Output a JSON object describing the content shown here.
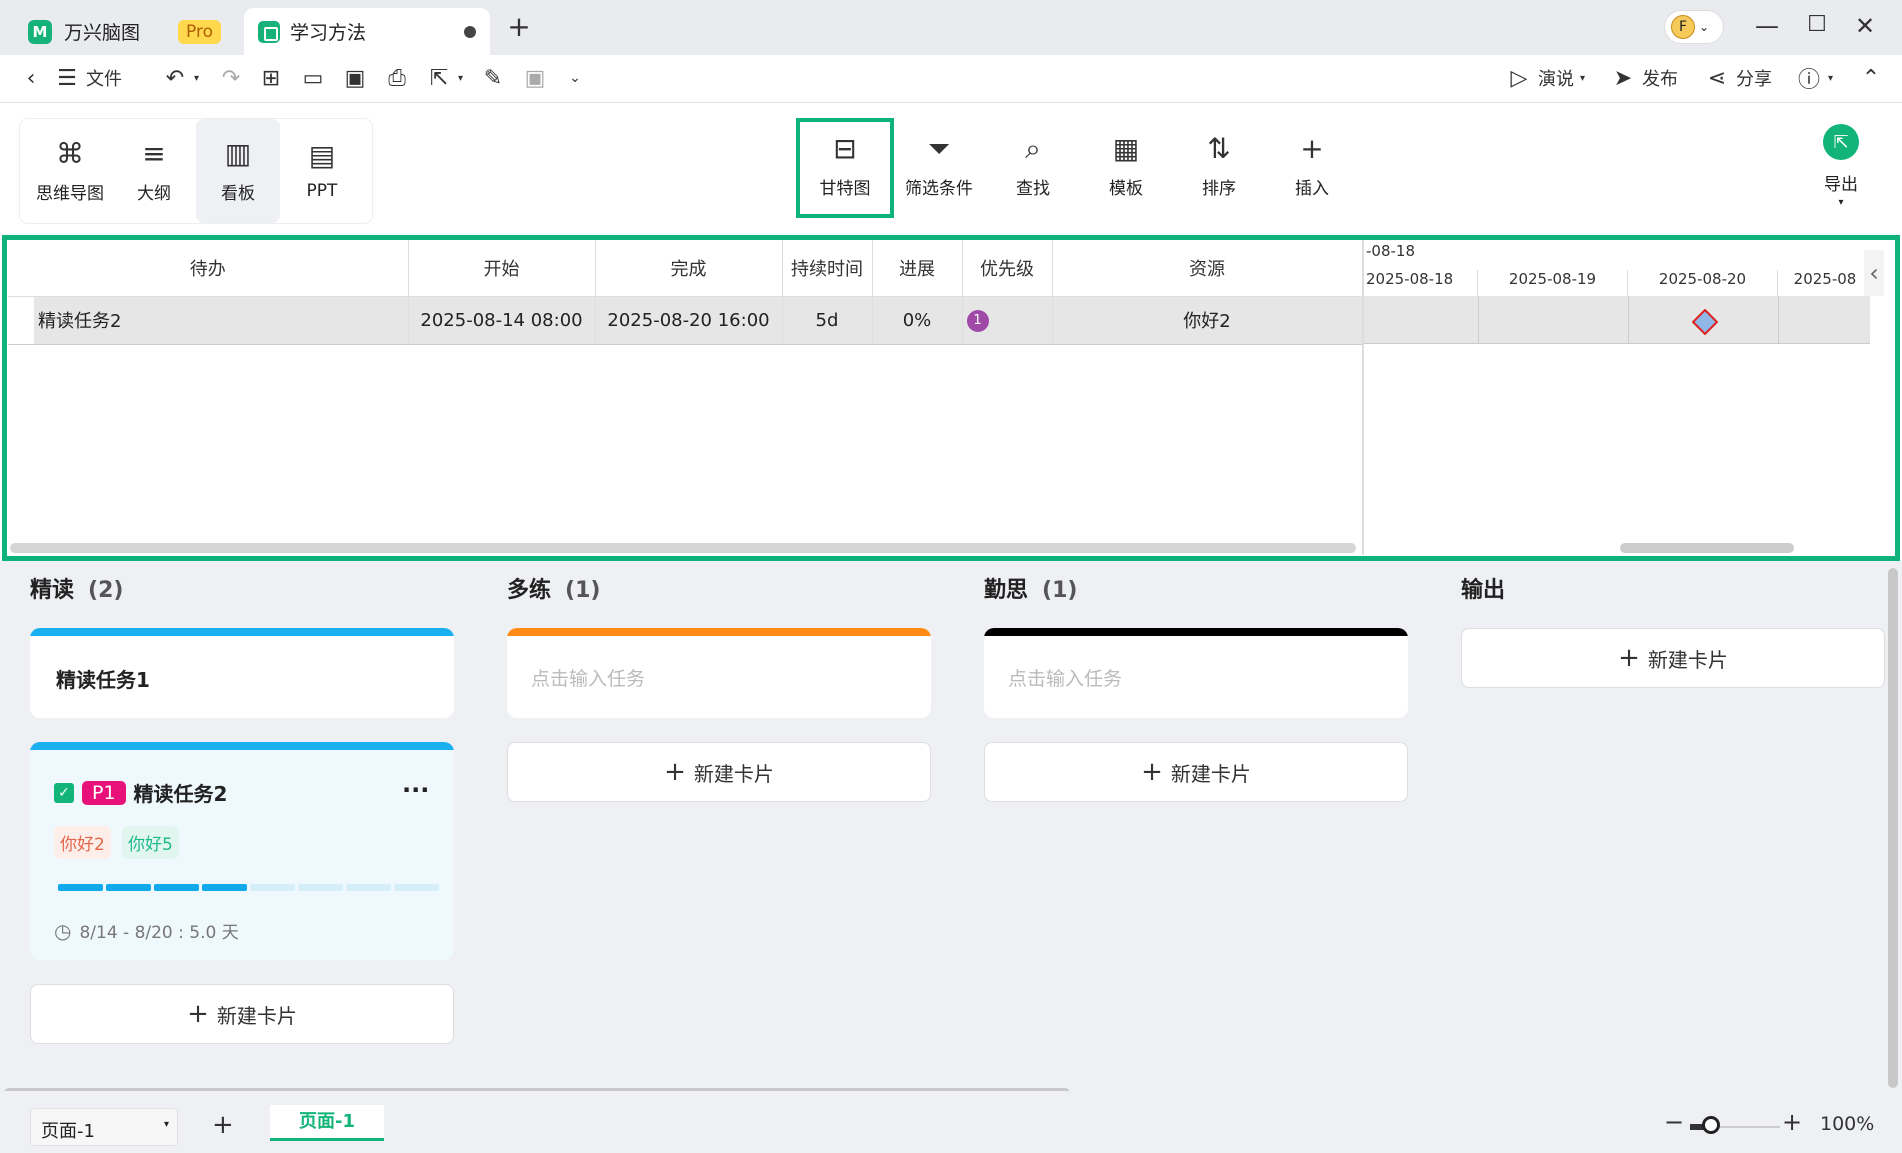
{
  "titlebar": {
    "app_name": "万兴脑图",
    "pro_label": "Pro",
    "doc_tab": "学习方法",
    "avatar_letter": "F"
  },
  "toolbar": {
    "file_label": "文件",
    "present_label": "演说",
    "publish_label": "发布",
    "share_label": "分享"
  },
  "views": [
    {
      "label": "思维导图",
      "icon": "mindmap-icon"
    },
    {
      "label": "大纲",
      "icon": "outline-icon"
    },
    {
      "label": "看板",
      "icon": "kanban-icon"
    },
    {
      "label": "PPT",
      "icon": "ppt-icon"
    }
  ],
  "ribbon": [
    {
      "label": "甘特图",
      "icon": "gantt-icon"
    },
    {
      "label": "筛选条件",
      "icon": "filter-icon"
    },
    {
      "label": "查找",
      "icon": "search-icon"
    },
    {
      "label": "模板",
      "icon": "template-icon"
    },
    {
      "label": "排序",
      "icon": "sort-icon"
    },
    {
      "label": "插入",
      "icon": "plus-icon"
    }
  ],
  "export_label": "导出",
  "gantt": {
    "headers": [
      "待办",
      "开始",
      "完成",
      "持续时间",
      "进展",
      "优先级",
      "资源"
    ],
    "row": {
      "task": "精读任务2",
      "start": "2025-08-14 08:00",
      "end": "2025-08-20 16:00",
      "duration": "5d",
      "progress": "0%",
      "priority": "1",
      "resource": "你好2"
    },
    "timeline_month": "-08-18",
    "timeline_days": [
      "2025-08-18",
      "2025-08-19",
      "2025-08-20",
      "2025-08"
    ]
  },
  "kanban": {
    "columns": [
      {
        "title": "精读",
        "count": "(2)",
        "color": "#1ab0f0"
      },
      {
        "title": "多练",
        "count": "(1)",
        "color": "#ff8a14"
      },
      {
        "title": "勤思",
        "count": "(1)",
        "color": "#000000"
      },
      {
        "title": "输出",
        "count": "",
        "color": ""
      }
    ],
    "card1_title": "精读任务1",
    "card2": {
      "priority": "P1",
      "title": "精读任务2",
      "tags": [
        "你好2",
        "你好5"
      ],
      "progress_done": 4,
      "progress_total": 8,
      "date_range": "8/14 - 8/20 : 5.0 天"
    },
    "placeholder": "点击输入任务",
    "new_card": "新建卡片"
  },
  "status": {
    "page_select": "页面-1",
    "page_tab": "页面-1",
    "zoom": "100%"
  },
  "colors": {
    "accent": "#12b47a",
    "highlight": "#0fb27a"
  }
}
